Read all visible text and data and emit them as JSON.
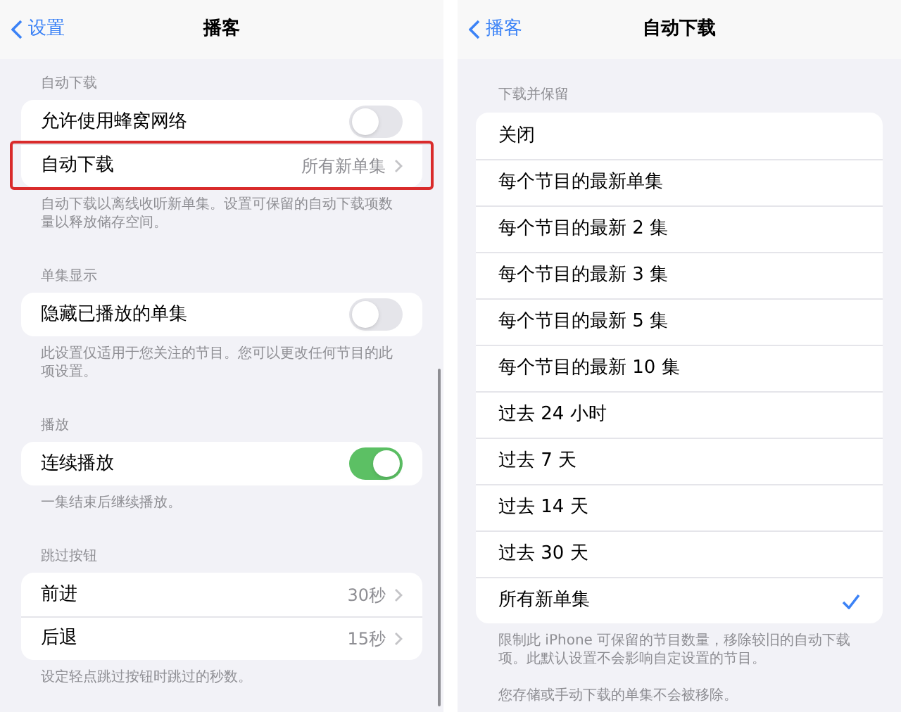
{
  "left": {
    "nav": {
      "back": "设置",
      "title": "播客"
    },
    "sections": [
      {
        "header": "自动下载",
        "rows": [
          {
            "kind": "toggle",
            "label": "允许使用蜂窝网络",
            "on": false,
            "highlighted": false
          },
          {
            "kind": "link",
            "label": "自动下载",
            "value": "所有新单集",
            "highlighted": true
          }
        ],
        "footer": "自动下载以离线收听新单集。设置可保留的自动下载项数量以释放储存空间。"
      },
      {
        "header": "单集显示",
        "rows": [
          {
            "kind": "toggle",
            "label": "隐藏已播放的单集",
            "on": false,
            "highlighted": false
          }
        ],
        "footer": "此设置仅适用于您关注的节目。您可以更改任何节目的此项设置。"
      },
      {
        "header": "播放",
        "rows": [
          {
            "kind": "toggle",
            "label": "连续播放",
            "on": true,
            "highlighted": false
          }
        ],
        "footer": "一集结束后继续播放。"
      },
      {
        "header": "跳过按钮",
        "rows": [
          {
            "kind": "link",
            "label": "前进",
            "value": "30秒",
            "highlighted": false
          },
          {
            "kind": "link",
            "label": "后退",
            "value": "15秒",
            "highlighted": false
          }
        ],
        "footer": "设定轻点跳过按钮时跳过的秒数。"
      }
    ]
  },
  "right": {
    "nav": {
      "back": "播客",
      "title": "自动下载"
    },
    "header": "下载并保留",
    "options": [
      {
        "label": "关闭",
        "selected": false
      },
      {
        "label": "每个节目的最新单集",
        "selected": false
      },
      {
        "label": "每个节目的最新 2 集",
        "selected": false
      },
      {
        "label": "每个节目的最新 3 集",
        "selected": false
      },
      {
        "label": "每个节目的最新 5 集",
        "selected": false
      },
      {
        "label": "每个节目的最新 10 集",
        "selected": false
      },
      {
        "label": "过去 24 小时",
        "selected": false
      },
      {
        "label": "过去 7 天",
        "selected": false
      },
      {
        "label": "过去 14 天",
        "selected": false
      },
      {
        "label": "过去 30 天",
        "selected": false
      },
      {
        "label": "所有新单集",
        "selected": true
      }
    ],
    "footers": [
      "限制此 iPhone 可保留的节目数量，移除较旧的自动下载项。此默认设置不会影响自定设置的节目。",
      "您存储或手动下载的单集不会被移除。"
    ]
  }
}
